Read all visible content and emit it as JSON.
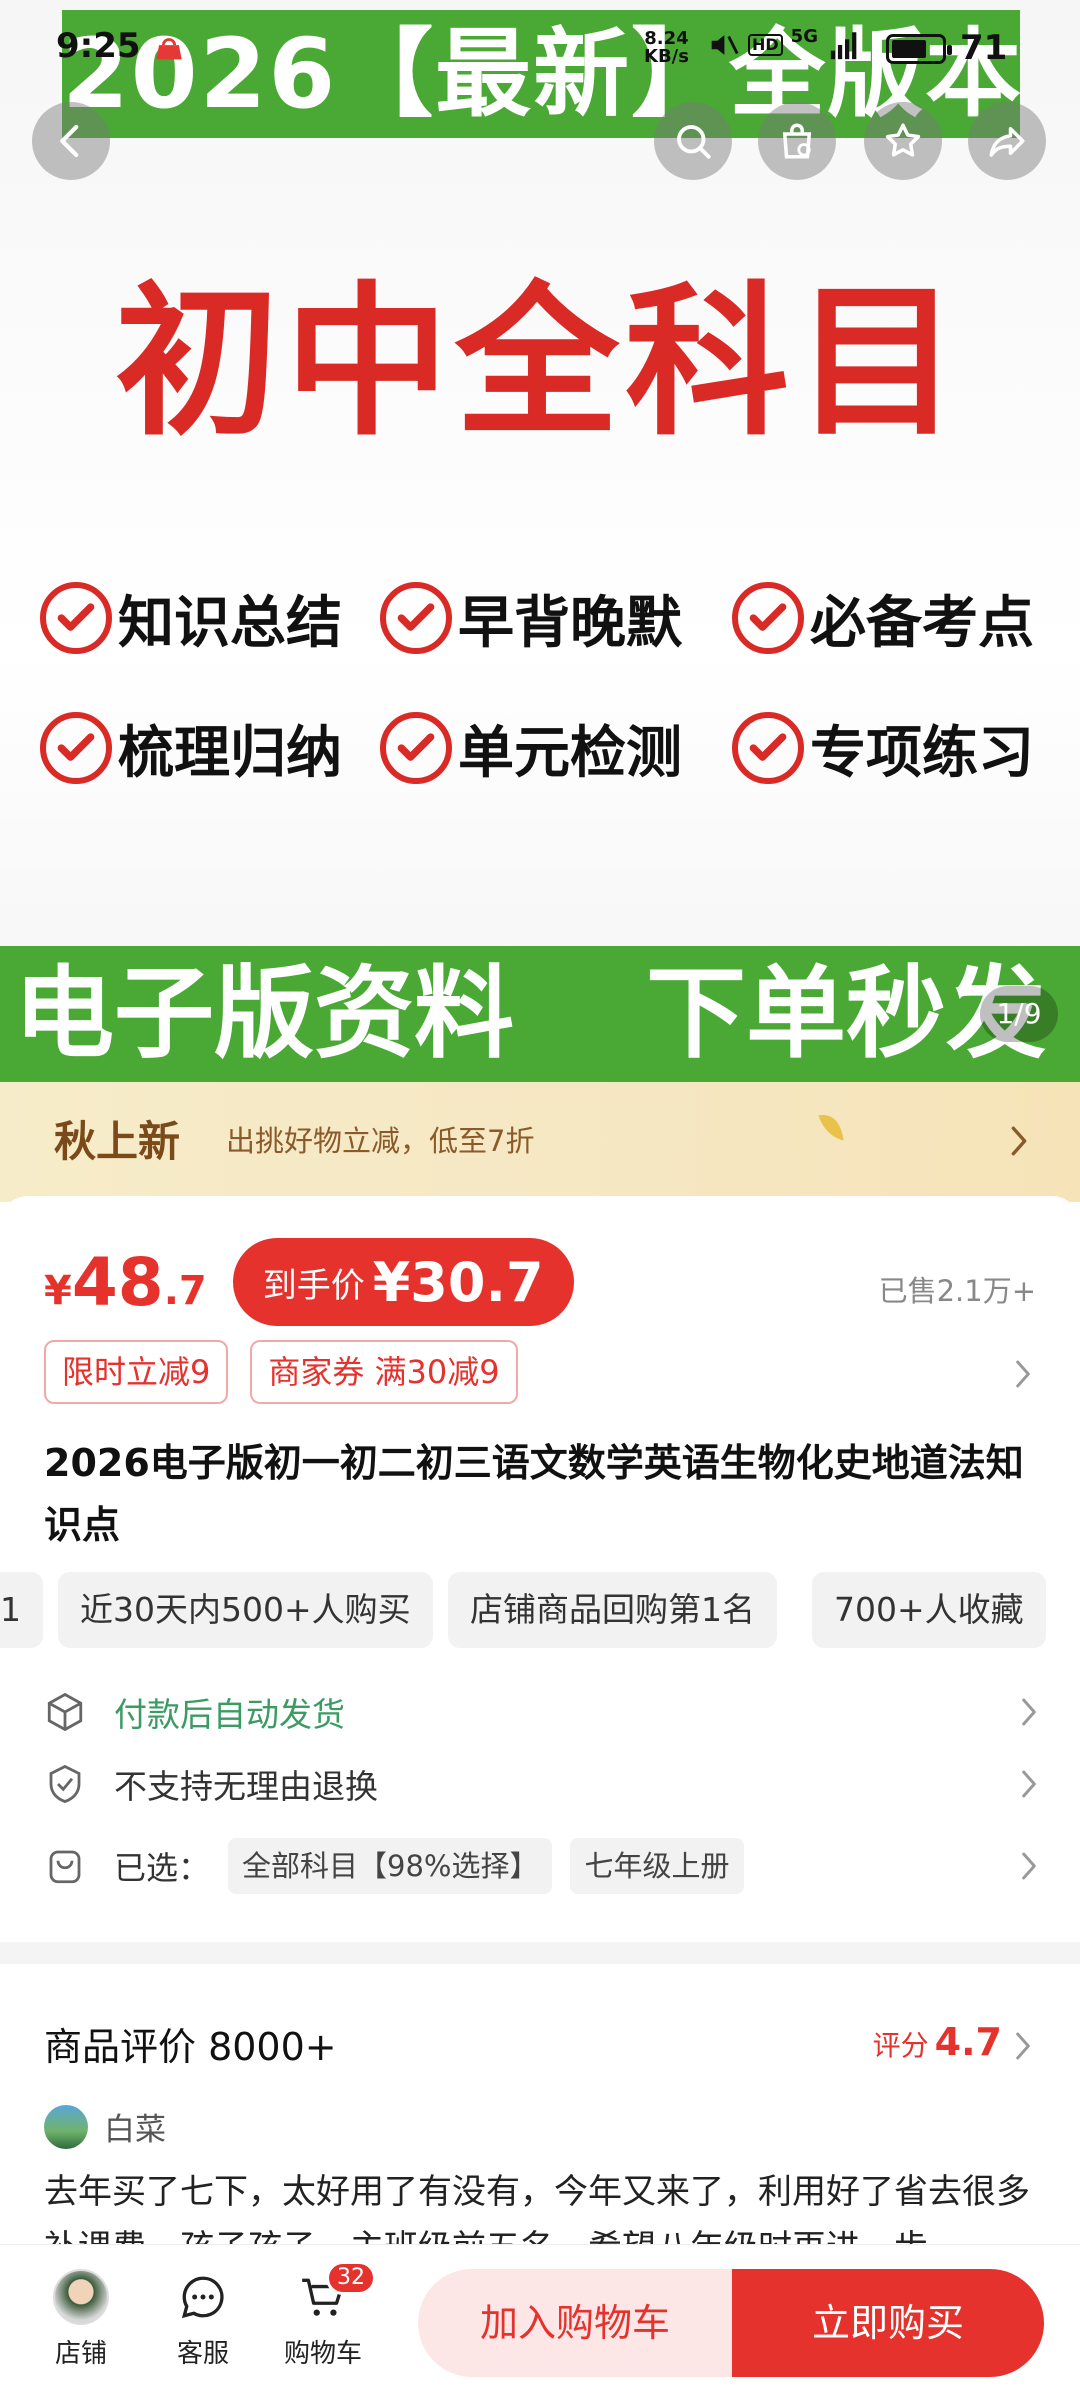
{
  "status_bar": {
    "time": "9:25",
    "speed_value": "8.24",
    "speed_unit": "KB/s",
    "network": "5G",
    "hd": "HD",
    "battery_percent": "71",
    "battery_level": 0.71
  },
  "hero": {
    "top_band": "2026【最新】全版本",
    "title": "初中全科目",
    "features": [
      "知识总结",
      "早背晚默",
      "必备考点",
      "梳理归纳",
      "单元检测",
      "专项练习"
    ],
    "bottom_left": "电子版资料",
    "bottom_right": "下单秒发",
    "counter": "1/9"
  },
  "nav": {
    "back_icon": "chevron-left-icon",
    "search_icon": "search-icon",
    "bag_icon": "shopping-bag-icon",
    "star_icon": "star-icon",
    "share_icon": "share-icon"
  },
  "promo": {
    "title": "秋上新",
    "subtitle": "出挑好物立减，低至7折"
  },
  "product": {
    "price_symbol": "¥",
    "price_int": "48",
    "price_dec": ".7",
    "final_label": "到手价",
    "final_price": "¥30.7",
    "sold": "已售2.1万+",
    "coupons": [
      "限时立减9",
      "商家券 满30减9"
    ],
    "title": "2026电子版初一初二初三语文数学英语生物化史地道法知识点",
    "tags": [
      "1",
      "近30天内500+人购买",
      "店铺商品回购第1名",
      "700+人收藏"
    ],
    "services": [
      {
        "icon": "box-icon",
        "text": "付款后自动发货"
      },
      {
        "icon": "shield-check-icon",
        "text": "不支持无理由退换"
      }
    ],
    "selected_label": "已选：",
    "selected_chips": [
      "全部科目【98%选择】",
      "七年级上册"
    ]
  },
  "reviews": {
    "title": "商品评价 8000+",
    "score_label": "评分",
    "score": "4.7",
    "reviewer": "白菜",
    "text": "去年买了七下，太好用了有没有，今年又来了，利用好了省去很多补课费，孩子孩子，主班级前五名，希望八年级时再进一步"
  },
  "bottom_bar": {
    "shop_label": "店铺",
    "service_label": "客服",
    "cart_label": "购物车",
    "cart_count": "32",
    "add_to_cart": "加入购物车",
    "buy_now": "立即购买"
  },
  "colors": {
    "brand_red": "#e5322d",
    "band_green": "#4aa935",
    "hero_red": "#d92a26",
    "service_green": "#3a9b63"
  }
}
